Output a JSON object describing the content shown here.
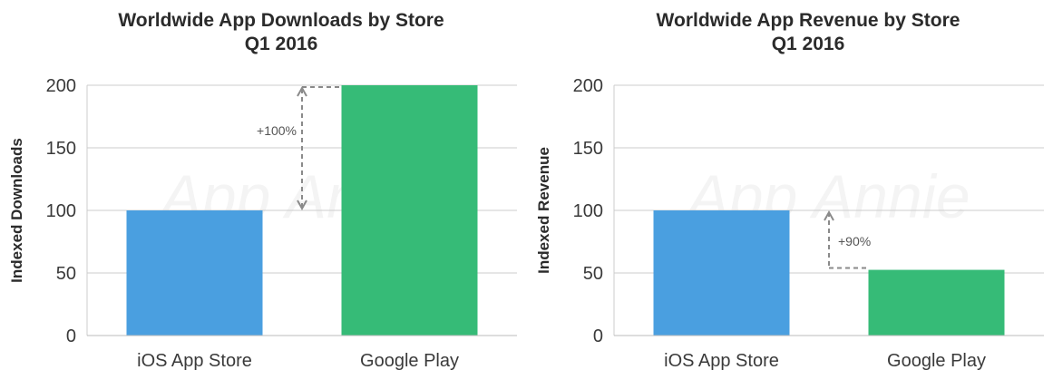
{
  "chart_data": [
    {
      "type": "bar",
      "title": "Worldwide App Downloads by Store",
      "subtitle": "Q1 2016",
      "ylabel": "Indexed Downloads",
      "xlabel": "",
      "ylim": [
        0,
        200
      ],
      "yticks": [
        0,
        50,
        100,
        150,
        200
      ],
      "grid": true,
      "categories": [
        "iOS App Store",
        "Google Play"
      ],
      "values": [
        100,
        200
      ],
      "colors": [
        "#4a9fe0",
        "#36bb77"
      ],
      "annotation": {
        "text": "+100%",
        "from": 100,
        "to": 200
      }
    },
    {
      "type": "bar",
      "title": "Worldwide App Revenue by Store",
      "subtitle": "Q1 2016",
      "ylabel": "Indexed Revenue",
      "xlabel": "",
      "ylim": [
        0,
        200
      ],
      "yticks": [
        0,
        50,
        100,
        150,
        200
      ],
      "grid": true,
      "categories": [
        "iOS App Store",
        "Google Play"
      ],
      "values": [
        100,
        52.5
      ],
      "colors": [
        "#4a9fe0",
        "#36bb77"
      ],
      "annotation": {
        "text": "+90%",
        "from": 52.5,
        "to": 100
      }
    }
  ],
  "watermark": "App Annie"
}
